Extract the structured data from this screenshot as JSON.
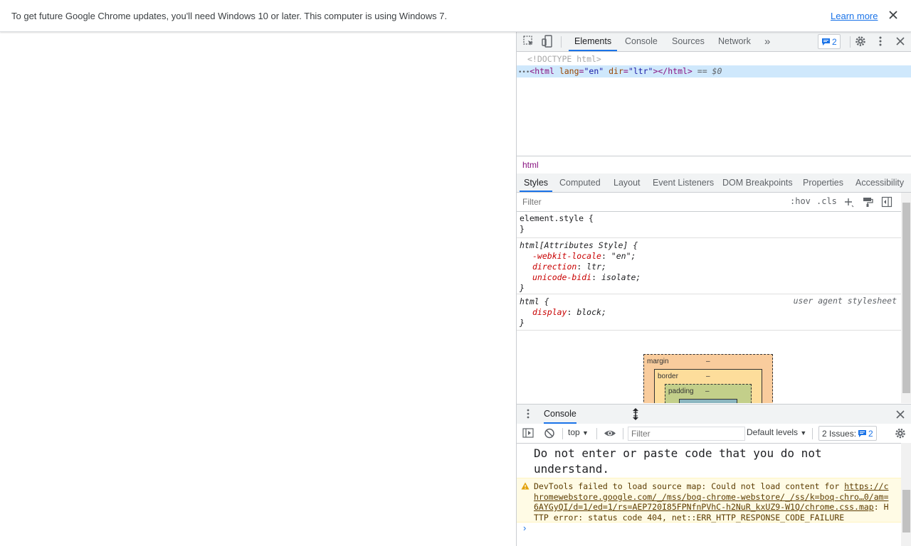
{
  "infobar": {
    "message": "To get future Google Chrome updates, you'll need Windows 10 or later. This computer is using Windows 7.",
    "learn_more": "Learn more"
  },
  "devtools": {
    "tabs": [
      "Elements",
      "Console",
      "Sources",
      "Network"
    ],
    "active_tab": "Elements",
    "more_tabs": "»",
    "message_count": "2",
    "dom": {
      "doctype": "<!DOCTYPE html>",
      "html_open": "<html",
      "lang_attr": "lang",
      "lang_val": "\"en\"",
      "dir_attr": "dir",
      "dir_val": "\"ltr\"",
      "html_close": "></html>",
      "selected_marker": "== $0",
      "dots": "•••"
    },
    "breadcrumb": "html",
    "styles_tabs": [
      "Styles",
      "Computed",
      "Layout",
      "Event Listeners",
      "DOM Breakpoints",
      "Properties",
      "Accessibility"
    ],
    "filter_placeholder": "Filter",
    "hov": ":hov",
    "cls": ".cls",
    "rules": {
      "r1_sel": "element.style {",
      "r1_end": "}",
      "r2_sel": "html[Attributes Style] {",
      "r2_p1": "-webkit-locale",
      "r2_v1": "\"en\";",
      "r2_p2": "direction",
      "r2_v2": "ltr;",
      "r2_p3": "unicode-bidi",
      "r2_v3": "isolate;",
      "r2_end": "}",
      "r3_sel": "html {",
      "r3_source": "user agent stylesheet",
      "r3_p1": "display",
      "r3_v1": "block;",
      "r3_end": "}"
    },
    "box_model": {
      "margin": "margin",
      "border": "border",
      "padding": "padding",
      "dash": "–"
    },
    "drawer": {
      "tab": "Console",
      "context": "top",
      "filter_placeholder": "Filter",
      "levels": "Default levels",
      "issues_label": "2 Issues:",
      "issues_count": "2",
      "big_message": "Do not enter or paste code that you do not understand.",
      "warning_prefix": "DevTools failed to load source map: Could not load content for ",
      "warning_link": "https://chromewebstore.google.com/_/mss/boq-chrome-webstore/_/ss/k=boq-chro…0/am=6AYGyQI/d=1/ed=1/rs=AEP720I85FPNfnPVhC-h2NuR_kxUZ9-W1Q/chrome.css.map",
      "warning_suffix": ": HTTP error: status code 404, net::ERR_HTTP_RESPONSE_CODE_FAILURE",
      "prompt": "›"
    }
  }
}
